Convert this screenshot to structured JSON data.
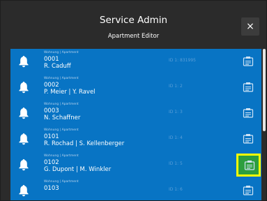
{
  "header": {
    "title": "Service Admin",
    "subtitle": "Apartment Editor",
    "close_label": "×"
  },
  "list": {
    "items": [
      {
        "tiny": "Wohnung | Apartment",
        "number": "0001",
        "names": "R. Caduff",
        "id": "ID 1: 831995",
        "highlighted": false
      },
      {
        "tiny": "Wohnung | Apartment",
        "number": "0002",
        "names": "P. Meier | Y. Ravel",
        "id": "ID 1: 2",
        "highlighted": false
      },
      {
        "tiny": "Wohnung | Apartment",
        "number": "0003",
        "names": "N. Schaffner",
        "id": "ID 1: 3",
        "highlighted": false
      },
      {
        "tiny": "Wohnung | Apartment",
        "number": "0101",
        "names": "R. Rochad | S. Kellenberger",
        "id": "ID 1: 4",
        "highlighted": false
      },
      {
        "tiny": "Wohnung | Apartment",
        "number": "0102",
        "names": "G. Dupont | M. Winkler",
        "id": "ID 1: 5",
        "highlighted": true
      },
      {
        "tiny": "Wohnung | Apartment",
        "number": "0103",
        "names": "",
        "id": "ID 1: 6",
        "highlighted": false
      }
    ]
  },
  "icons": {
    "row_left": "bell-icon",
    "row_right": "edit-card-icon",
    "close": "close-icon"
  },
  "colors": {
    "modal_bg": "#2b2b2b",
    "row_bg": "#0874c4",
    "highlight_border": "#ffff00",
    "highlight_fill": "#2d9e3f"
  }
}
